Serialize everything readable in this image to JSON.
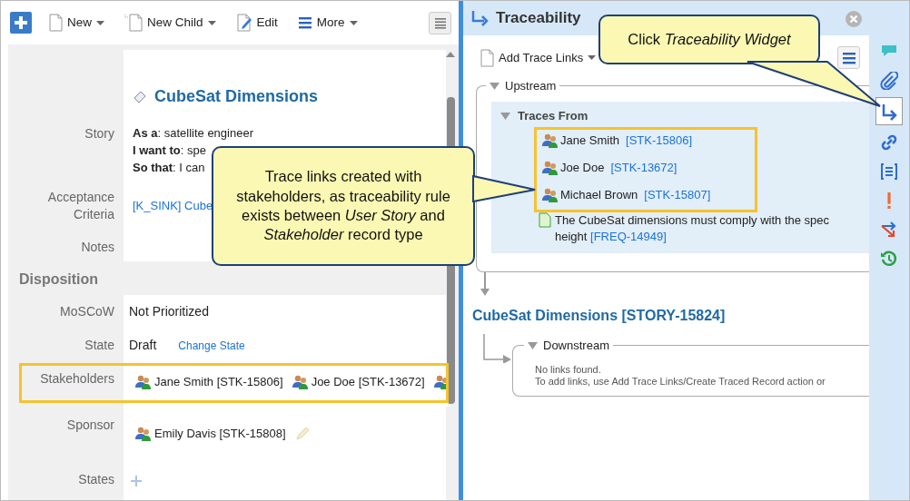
{
  "toolbar": {
    "buttons": [
      {
        "kind": "add"
      },
      {
        "kind": "new",
        "label": "New",
        "caret": true
      },
      {
        "kind": "new_child",
        "label": "New Child",
        "caret": true
      },
      {
        "kind": "edit",
        "label": "Edit",
        "caret": false
      },
      {
        "kind": "more",
        "label": "More",
        "caret": true
      },
      {
        "kind": "menu"
      }
    ]
  },
  "record": {
    "title": "CubeSat Dimensions",
    "fields": [
      {
        "kind": "story",
        "label": "Story",
        "lines": [
          "**As a**: satellite engineer",
          "**I want to**: spe",
          "**So that**: I can"
        ]
      },
      {
        "kind": "link",
        "label": "Acceptance Criteria",
        "value": "[K_SINK] Cube"
      },
      {
        "kind": "text",
        "label": "Notes"
      },
      {
        "kind": "section",
        "label": "Disposition"
      },
      {
        "kind": "text",
        "label": "MoSCoW",
        "value": "Not Prioritized"
      },
      {
        "kind": "state",
        "label": "State",
        "value": "Draft",
        "action": "Change State"
      },
      {
        "kind": "people",
        "label": "Stakeholders",
        "highlighted": true,
        "people": [
          {
            "kind": "person",
            "name": "Jane Smith [STK-15806]"
          },
          {
            "kind": "person",
            "name": "Joe Doe [STK-13672]"
          },
          {
            "kind": "partial"
          }
        ]
      },
      {
        "kind": "people",
        "label": "Sponsor",
        "editable": true,
        "people": [
          {
            "kind": "person",
            "name": "Emily Davis [STK-15808]"
          }
        ]
      },
      {
        "kind": "add",
        "label": "States"
      }
    ]
  },
  "traceability": {
    "title": "Traceability",
    "add_button": "Add Trace Links",
    "upstream": {
      "label": "Upstream",
      "expanded": true,
      "group": {
        "label": "Traces From",
        "expanded": true,
        "highlighted": true,
        "items": [
          {
            "kind": "person",
            "name": "Jane Smith",
            "id": "[STK-15806]"
          },
          {
            "kind": "person",
            "name": "Joe Doe",
            "id": "[STK-13672]"
          },
          {
            "kind": "person",
            "name": "Michael Brown",
            "id": "[STK-15807]"
          },
          {
            "kind": "requirement",
            "lines": [
              "The CubeSat dimensions must comply with the spec",
              "height"
            ],
            "id": "[FREQ-14949]"
          }
        ]
      }
    },
    "current": "CubeSat Dimensions [STORY-15824]",
    "downstream": {
      "label": "Downstream",
      "expanded": true,
      "message": [
        "No links found.",
        "To add links, use Add Trace Links/Create Traced Record action or"
      ]
    }
  },
  "widgets": [
    {
      "kind": "comments",
      "selected": false
    },
    {
      "kind": "attachments",
      "selected": false
    },
    {
      "kind": "traceability",
      "selected": true
    },
    {
      "kind": "links",
      "selected": false
    },
    {
      "kind": "list",
      "selected": false
    },
    {
      "kind": "alert",
      "selected": false
    },
    {
      "kind": "impact",
      "selected": false
    },
    {
      "kind": "history",
      "selected": false
    }
  ],
  "callouts": [
    {
      "text": "Trace links created with stakeholders, as traceability rule exists between *User Story* and *Stakeholder* record type"
    },
    {
      "text": "Click *Traceability Widget*"
    }
  ]
}
